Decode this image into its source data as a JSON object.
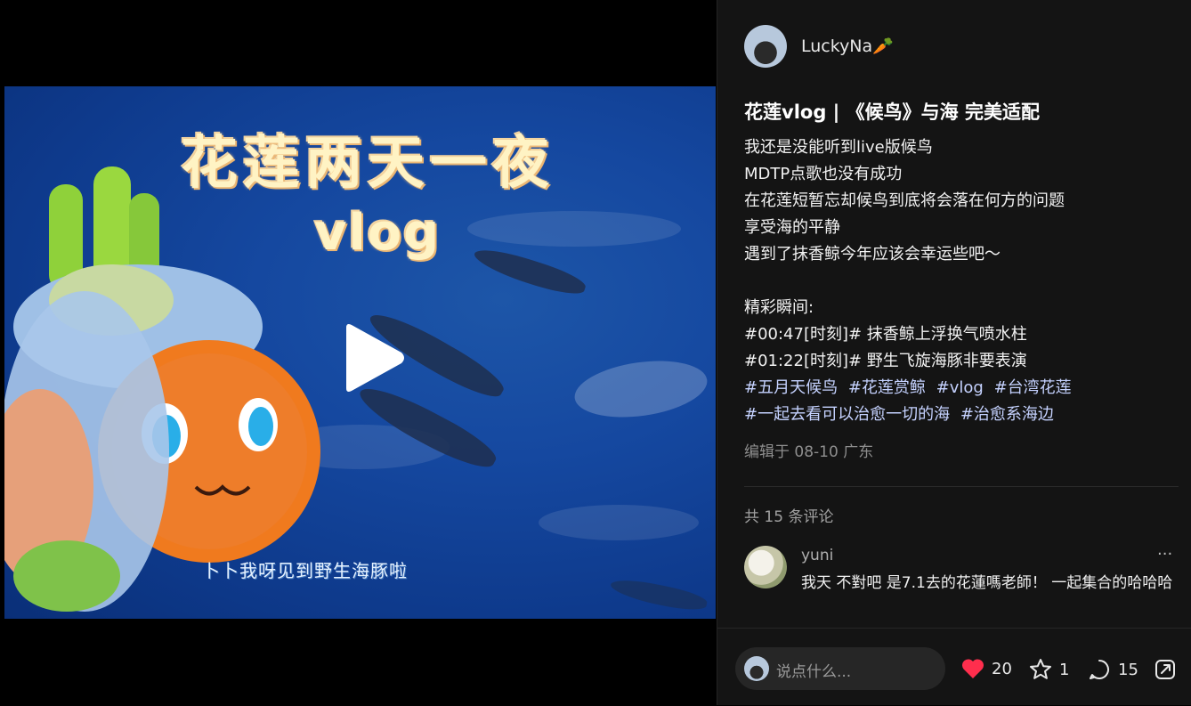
{
  "video": {
    "overlay_title_line1": "花莲两天一夜",
    "overlay_title_line2": "vlog",
    "overlay_caption": "卜卜我呀见到野生海豚啦",
    "play_icon": "play-icon"
  },
  "author": {
    "name": "LuckyNa🥕"
  },
  "post": {
    "title": "花莲vlog | 《候鸟》与海 完美适配",
    "lines": [
      "我还是没能听到live版候鸟",
      "MDTP点歌也没有成功",
      "在花莲短暂忘却候鸟到底将会落在何方的问题",
      "享受海的平静",
      "遇到了抹香鲸今年应该会幸运些吧～",
      "",
      "精彩瞬间:",
      "#00:47[时刻]# 抹香鲸上浮换气喷水柱",
      "#01:22[时刻]# 野生飞旋海豚非要表演"
    ],
    "tags_row1": [
      "#五月天候鸟",
      "#花莲赏鲸",
      "#vlog",
      "#台湾花莲"
    ],
    "tags_row2": [
      "#一起去看可以治愈一切的海",
      "#治愈系海边"
    ],
    "edit_info": "编辑于 08-10 广东"
  },
  "comments": {
    "count_label": "共 15 条评论",
    "items": [
      {
        "author": "yuni",
        "text": "我天 不對吧 是7.1去的花蓮嗎老師！ 一起集合的哈哈哈",
        "more_icon": "ellipsis-icon"
      }
    ]
  },
  "bottom_bar": {
    "input_placeholder": "说点什么...",
    "likes": "20",
    "stars": "1",
    "comments": "15",
    "like_color": "#ff2e4d"
  }
}
